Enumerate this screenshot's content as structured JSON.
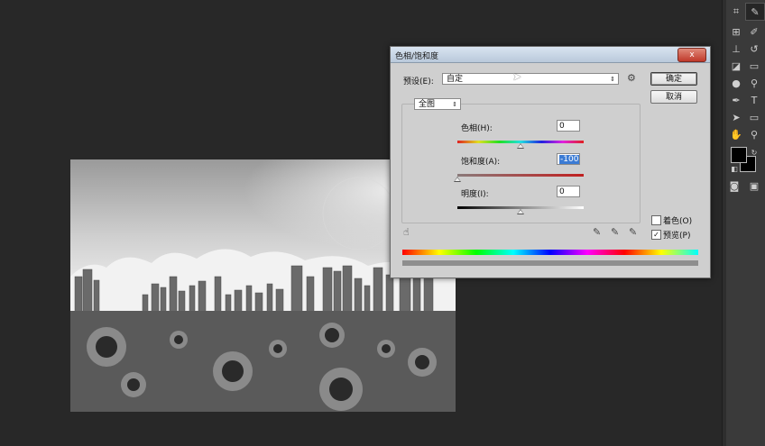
{
  "dialog": {
    "title": "色相/饱和度",
    "close_label": "x",
    "preset_label": "预设(E):",
    "preset_value": "自定",
    "ok_label": "确定",
    "cancel_label": "取消",
    "channel_value": "全图",
    "hue_label": "色相(H):",
    "hue_value": "0",
    "saturation_label": "饱和度(A):",
    "saturation_value": "-100",
    "lightness_label": "明度(I):",
    "lightness_value": "0",
    "colorize_label": "着色(O)",
    "preview_label": "预览(P)",
    "preview_checked": "✓"
  },
  "sliders": {
    "hue_level": 0.5,
    "saturation_level": 0,
    "lightness_level": 0.5
  },
  "colors": {
    "workspace": "#282828",
    "dialog_bg": "#cfcfcf",
    "highlight": "#3b7bd4"
  },
  "tools": [
    "crop-icon",
    "eyedropper-icon",
    "heal-icon",
    "brush-icon",
    "stamp-icon",
    "history-brush-icon",
    "eraser-icon",
    "gradient-icon",
    "blur-icon",
    "dodge-icon",
    "pen-icon",
    "type-icon",
    "path-select-icon",
    "shape-icon",
    "hand-icon",
    "zoom-icon"
  ]
}
